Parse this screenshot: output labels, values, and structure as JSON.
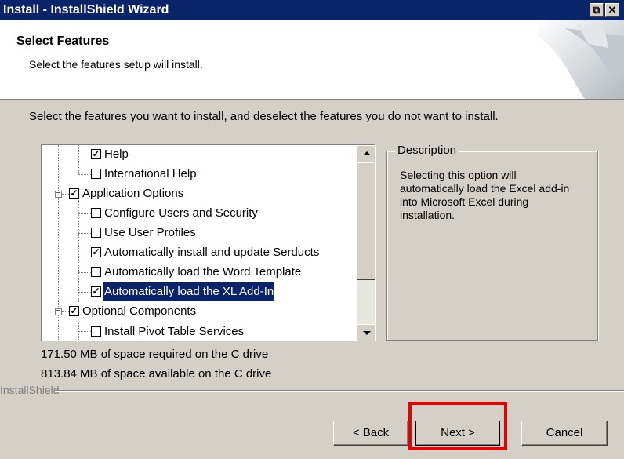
{
  "window": {
    "title": "Install - InstallShield Wizard",
    "restore_glyph": "⧉",
    "close_glyph": "✕"
  },
  "header": {
    "title": "Select Features",
    "subtitle": "Select the features setup will install."
  },
  "instruction": "Select the features you want to install, and deselect the features you do not want to install.",
  "tree": {
    "items": [
      {
        "label": "Help",
        "checked": true,
        "selected": false
      },
      {
        "label": "International Help",
        "checked": false,
        "selected": false
      },
      {
        "label": "Application Options",
        "checked": true,
        "selected": false,
        "expander": "−"
      },
      {
        "label": "Configure Users and Security",
        "checked": false,
        "selected": false
      },
      {
        "label": "Use User Profiles",
        "checked": false,
        "selected": false
      },
      {
        "label": "Automatically install and update Serducts",
        "checked": true,
        "selected": false
      },
      {
        "label": "Automatically load the Word Template",
        "checked": false,
        "selected": false
      },
      {
        "label": "Automatically load the XL Add-In",
        "checked": true,
        "selected": true
      },
      {
        "label": "Optional Components",
        "checked": true,
        "selected": false,
        "expander": "−"
      },
      {
        "label": "Install Pivot Table Services",
        "checked": false,
        "selected": false
      }
    ]
  },
  "description": {
    "legend": "Description",
    "text": "Selecting this option will automatically load the Excel add-in into Microsoft Excel during installation."
  },
  "space_required": "171.50 MB of space required on the C drive",
  "space_available": "813.84 MB of space available on the C drive",
  "brand": "InstallShield",
  "buttons": {
    "back": "< Back",
    "next": "Next >",
    "cancel": "Cancel"
  },
  "highlight_color": "#e60000"
}
